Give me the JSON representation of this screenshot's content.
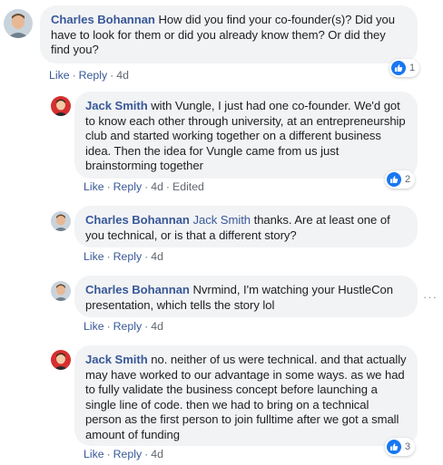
{
  "comments": [
    {
      "author": "Charles Bohannan",
      "mention": "",
      "text": "How did you find your co-founder(s)? Did you have to look for them or did you already know them? Or did they find you?",
      "like_label": "Like",
      "reply_label": "Reply",
      "time": "4d",
      "edited": "",
      "reactions": "1",
      "avatar": "charles-avatar"
    },
    {
      "author": "Jack Smith",
      "mention": "",
      "text": "with Vungle, I just had one co-founder. We'd got to know each other through university, at an entrepreneurship club and started working together on a different business idea. Then the idea for Vungle came from us just brainstorming together",
      "like_label": "Like",
      "reply_label": "Reply",
      "time": "4d",
      "edited": "Edited",
      "reactions": "2",
      "avatar": "jack-avatar"
    },
    {
      "author": "Charles Bohannan",
      "mention": "Jack Smith",
      "text": "thanks. Are at least one of you technical, or is that a different story?",
      "like_label": "Like",
      "reply_label": "Reply",
      "time": "4d",
      "edited": "",
      "reactions": "",
      "avatar": "charles-avatar"
    },
    {
      "author": "Charles Bohannan",
      "mention": "",
      "text": "Nvrmind, I'm watching your HustleCon presentation, which tells the story lol",
      "like_label": "Like",
      "reply_label": "Reply",
      "time": "4d",
      "edited": "",
      "reactions": "",
      "avatar": "charles-avatar"
    },
    {
      "author": "Jack Smith",
      "mention": "",
      "text": "no. neither of us were technical. and that actually may have worked to our advantage in some ways. as we had to fully validate the business concept before launching a single line of code. then we had to bring on a technical person as the first person to join fulltime after we got a small amount of funding",
      "like_label": "Like",
      "reply_label": "Reply",
      "time": "4d",
      "edited": "",
      "reactions": "3",
      "avatar": "jack-avatar"
    }
  ],
  "colors": {
    "author": "#385898",
    "bubble": "#f2f3f5",
    "like_badge": "#1877f2",
    "muted": "#606770"
  },
  "icons": {
    "like_badge": "thumbs-up-icon",
    "more": "more-options-icon"
  }
}
